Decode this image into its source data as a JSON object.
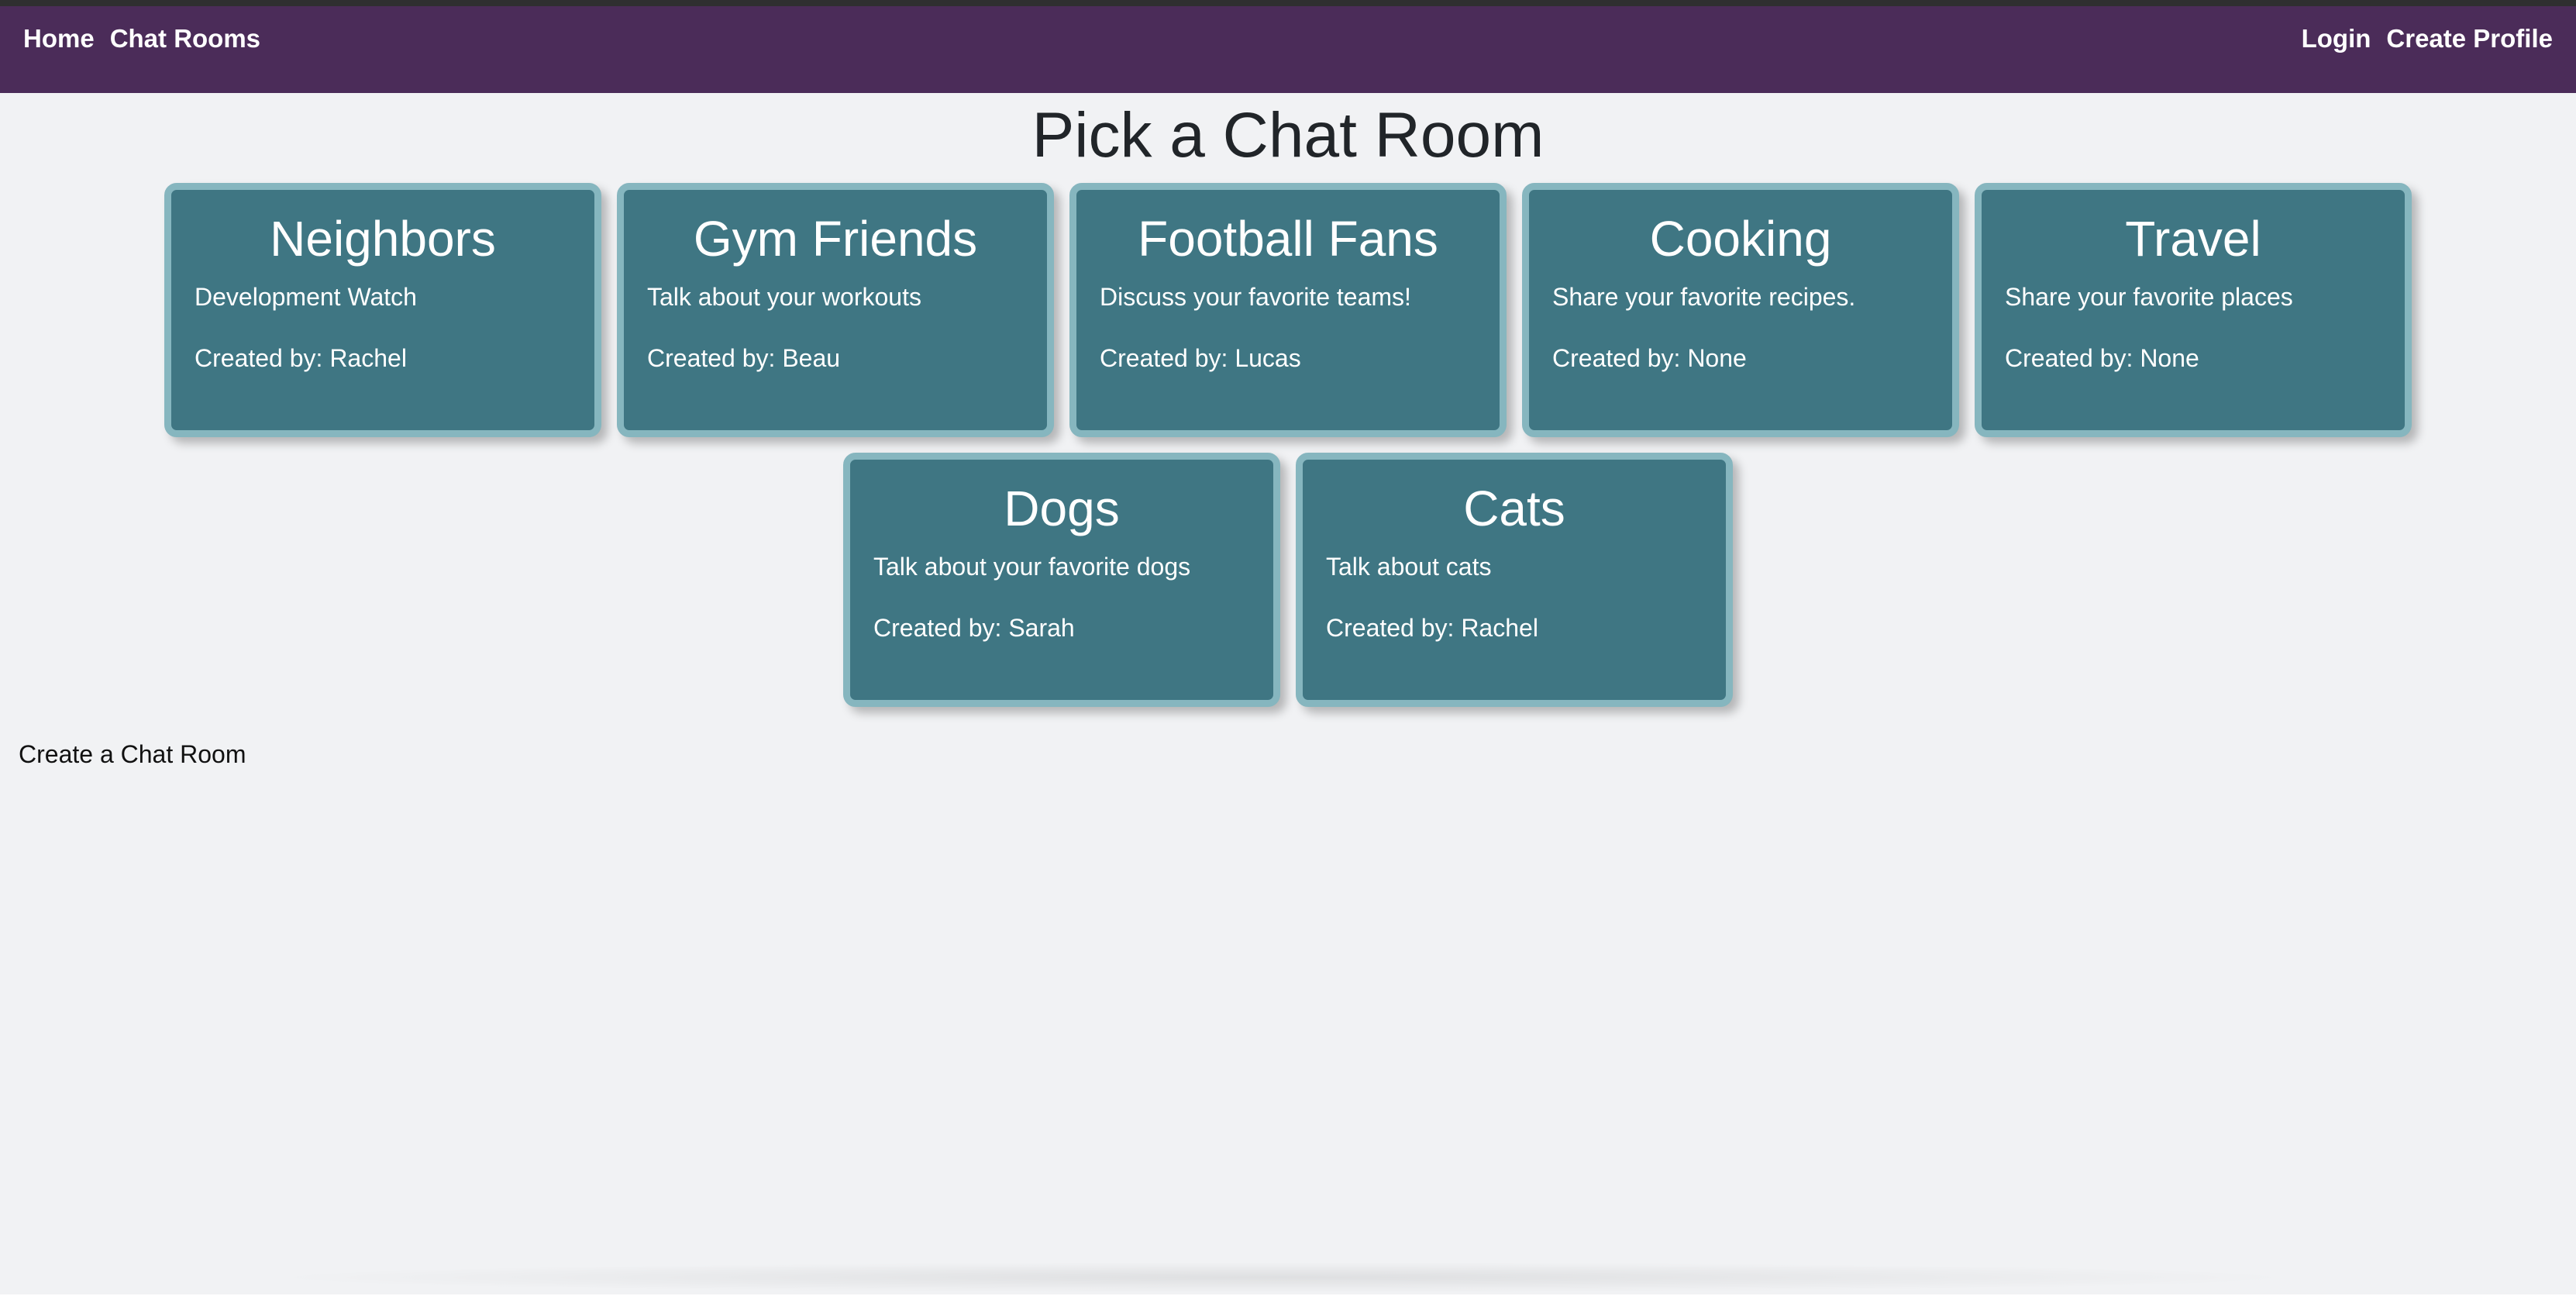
{
  "nav": {
    "left": [
      {
        "label": "Home"
      },
      {
        "label": "Chat Rooms"
      }
    ],
    "right": [
      {
        "label": "Login"
      },
      {
        "label": "Create Profile"
      }
    ]
  },
  "page": {
    "title": "Pick a Chat Room",
    "create_link": "Create a Chat Room"
  },
  "rooms": [
    {
      "name": "Neighbors",
      "description": "Development Watch",
      "creator": "Created by: Rachel"
    },
    {
      "name": "Gym Friends",
      "description": "Talk about your workouts",
      "creator": "Created by: Beau"
    },
    {
      "name": "Football Fans",
      "description": "Discuss your favorite teams!",
      "creator": "Created by: Lucas"
    },
    {
      "name": "Cooking",
      "description": "Share your favorite recipes.",
      "creator": "Created by: None"
    },
    {
      "name": "Travel",
      "description": "Share your favorite places",
      "creator": "Created by: None"
    },
    {
      "name": "Dogs",
      "description": "Talk about your favorite dogs",
      "creator": "Created by: Sarah"
    },
    {
      "name": "Cats",
      "description": "Talk about cats",
      "creator": "Created by: Rachel"
    }
  ],
  "colors": {
    "navbar": "#4b2c59",
    "card": "#3f7683",
    "card_border": "#86b6bf",
    "background": "#f1f2f4"
  }
}
